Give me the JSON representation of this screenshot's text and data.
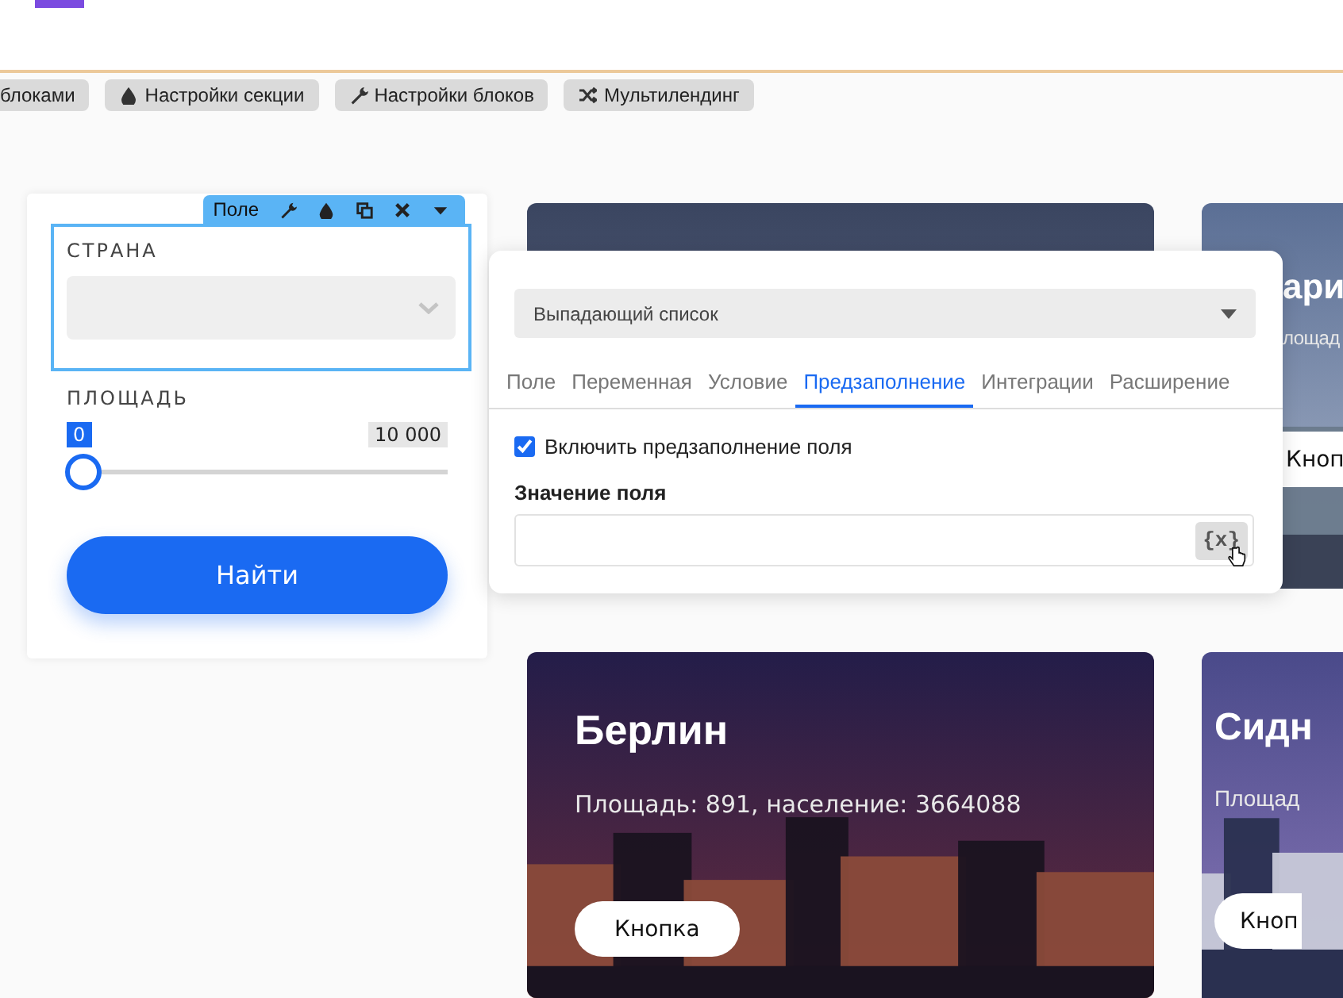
{
  "toolbar": [
    {
      "label": "блоками"
    },
    {
      "label": "Настройки секции"
    },
    {
      "label": "Настройки блоков"
    },
    {
      "label": "Мультилендинг"
    }
  ],
  "form": {
    "field_toolbar": {
      "label": "Поле"
    },
    "country": {
      "label": "СТРАНА"
    },
    "area": {
      "label": "ПЛОЩАДЬ",
      "min": "0",
      "max": "10 000",
      "level": 0
    },
    "submit": "Найти"
  },
  "cards": [
    {
      "kind": "picture"
    },
    {
      "kind": "picture",
      "title": "ари",
      "subtitle": "лощад",
      "button": "Кноп"
    },
    {
      "kind": "picture",
      "title": "Берлин",
      "subtitle": "Площадь: 891, население: 3664088",
      "button": "Кнопка"
    },
    {
      "kind": "picture",
      "title": "Сидн",
      "subtitle": "Площад",
      "button": "Кноп"
    }
  ],
  "popup": {
    "type_select": "Выпадающий список",
    "tabs": [
      {
        "label": "Поле",
        "selected": false
      },
      {
        "label": "Переменная",
        "selected": false
      },
      {
        "label": "Условие",
        "selected": false
      },
      {
        "label": "Предзаполнение",
        "selected": true
      },
      {
        "label": "Интеграции",
        "selected": false
      },
      {
        "label": "Расширение",
        "selected": false
      }
    ],
    "enable": {
      "label": "Включить предзаполнение поля",
      "checked": true
    },
    "value_label": "Значение поля",
    "variable_button": "{x}"
  }
}
